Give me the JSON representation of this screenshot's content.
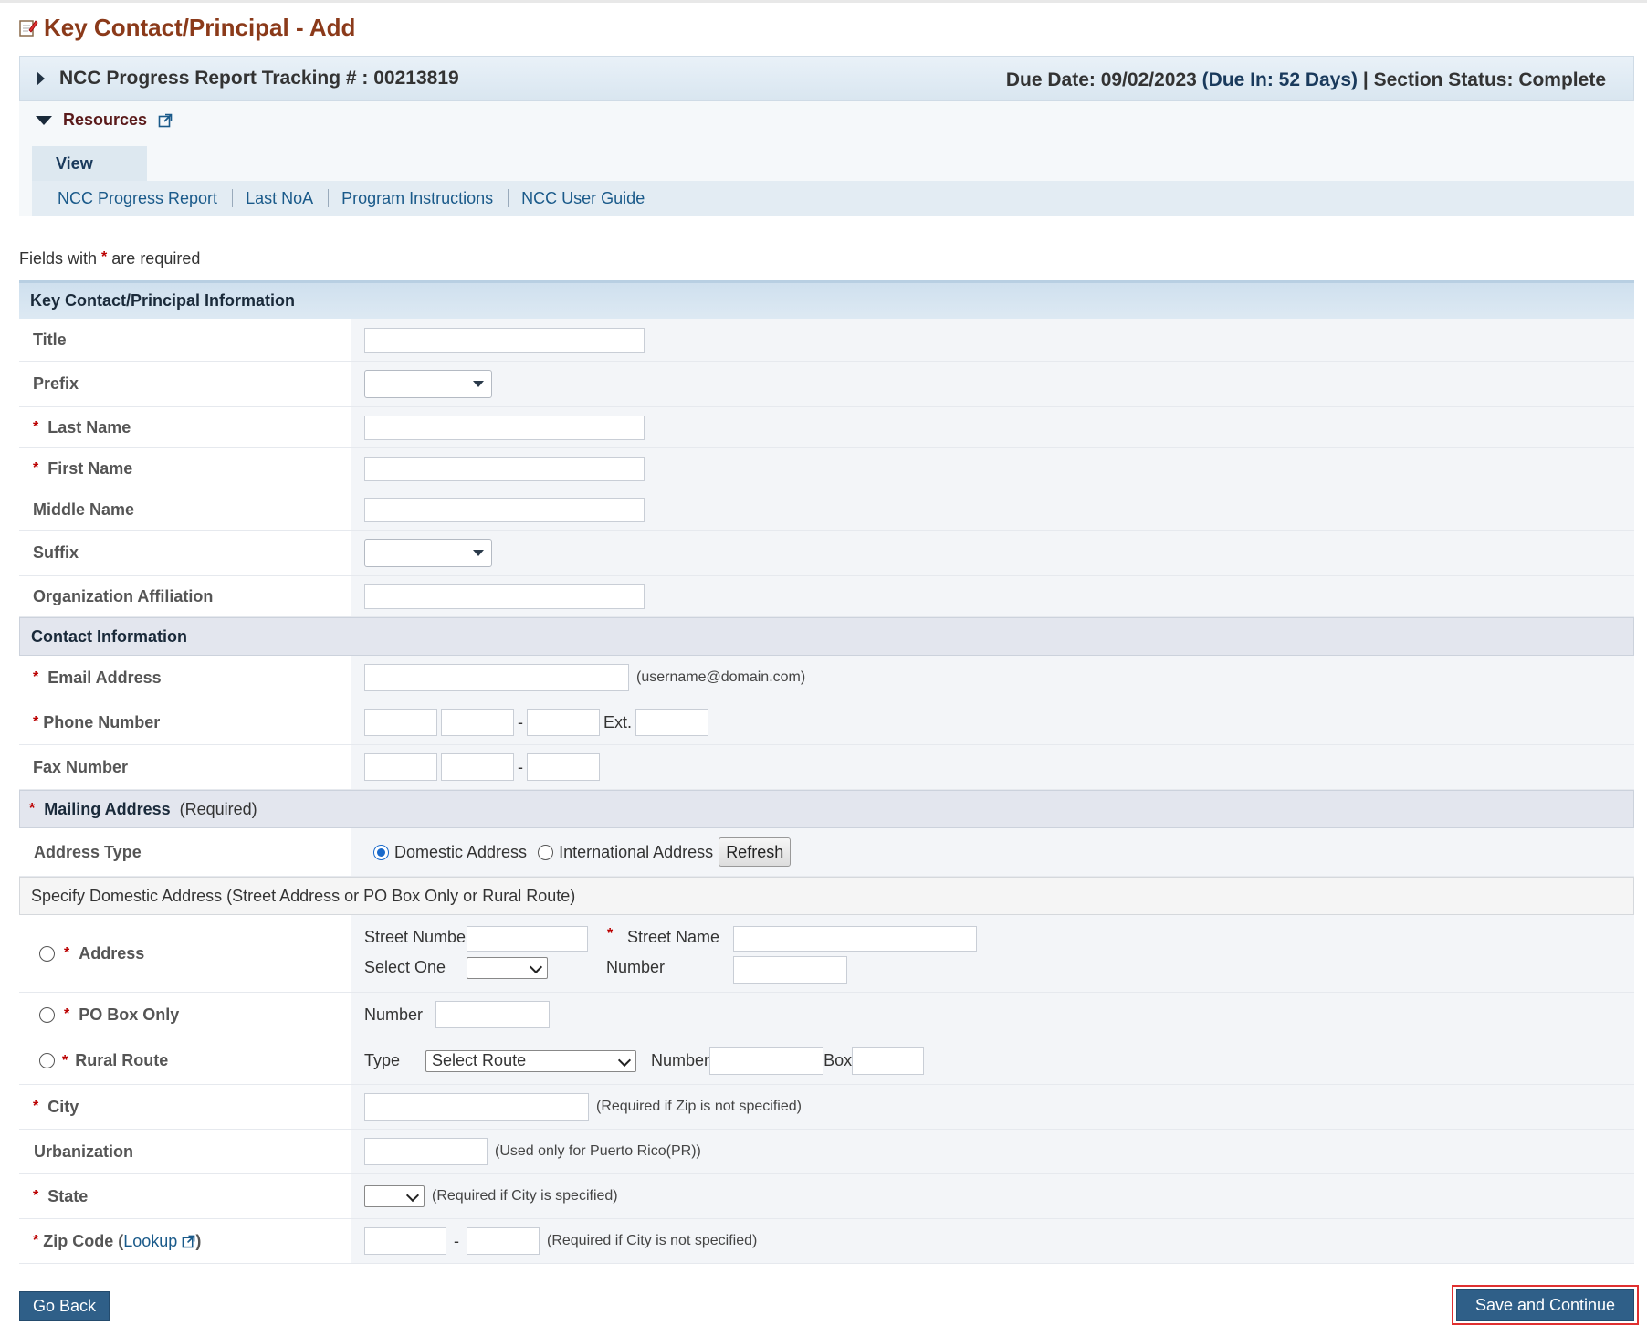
{
  "page": {
    "title": "Key Contact/Principal - Add"
  },
  "tracking": {
    "label": "NCC Progress Report Tracking # : 00213819",
    "due_date": "Due Date: 09/02/2023",
    "due_in": "(Due In: 52 Days)",
    "separator": "|",
    "section_status": "Section Status: Complete"
  },
  "resources": {
    "title": "Resources",
    "tab": "View",
    "links": [
      "NCC Progress Report",
      "Last NoA",
      "Program Instructions",
      "NCC User Guide"
    ]
  },
  "required_note": {
    "prefix": "Fields with",
    "suffix": "are required",
    "marker": "*"
  },
  "sections": {
    "key_contact": "Key Contact/Principal Information",
    "contact_info": "Contact Information",
    "mailing_address": "Mailing Address",
    "mailing_address_note": "(Required)",
    "domestic_specify": "Specify Domestic Address (Street Address or PO Box Only or Rural Route)"
  },
  "fields": {
    "title": {
      "label": "Title",
      "value": ""
    },
    "prefix": {
      "label": "Prefix",
      "value": ""
    },
    "last_name": {
      "label": "Last Name",
      "value": ""
    },
    "first_name": {
      "label": "First Name",
      "value": ""
    },
    "middle_name": {
      "label": "Middle Name",
      "value": ""
    },
    "suffix": {
      "label": "Suffix",
      "value": ""
    },
    "org_affiliation": {
      "label": "Organization Affiliation",
      "value": ""
    },
    "email": {
      "label": "Email Address",
      "hint": "(username@domain.com)",
      "value": ""
    },
    "phone": {
      "label": "Phone Number",
      "dash": "-",
      "ext": "Ext."
    },
    "fax": {
      "label": "Fax Number",
      "dash": "-"
    },
    "address_type": {
      "label": "Address Type",
      "domestic": "Domestic Address",
      "international": "International Address",
      "refresh": "Refresh",
      "selected": "Domestic Address"
    },
    "address": {
      "label": "Address",
      "street_number": "Street Number",
      "street_name": "Street Name",
      "select_one": "Select One",
      "number": "Number"
    },
    "po_box": {
      "label": "PO Box Only",
      "number": "Number"
    },
    "rural_route": {
      "label": "Rural Route",
      "type": "Type",
      "type_value": "Select Route",
      "number": "Number",
      "box": "Box"
    },
    "city": {
      "label": "City",
      "hint": "(Required if Zip is not specified)"
    },
    "urbanization": {
      "label": "Urbanization",
      "hint": "(Used only for Puerto Rico(PR))"
    },
    "state": {
      "label": "State",
      "hint": "(Required if City is specified)"
    },
    "zip": {
      "label_prefix": "Zip Code (",
      "lookup": "Lookup",
      "label_suffix": " )",
      "dash": "-",
      "hint": "(Required if City is not specified)"
    }
  },
  "buttons": {
    "go_back": "Go Back",
    "save_continue": "Save and Continue"
  },
  "colors": {
    "title": "#8b3a1a",
    "button": "#2f5f88",
    "required": "#b00000",
    "link": "#1a5a8a",
    "highlight": "#e03030"
  },
  "icons": {
    "page": "edit-document-icon",
    "external": "external-link-icon",
    "expand": "caret-right-icon",
    "collapse": "caret-down-icon"
  }
}
